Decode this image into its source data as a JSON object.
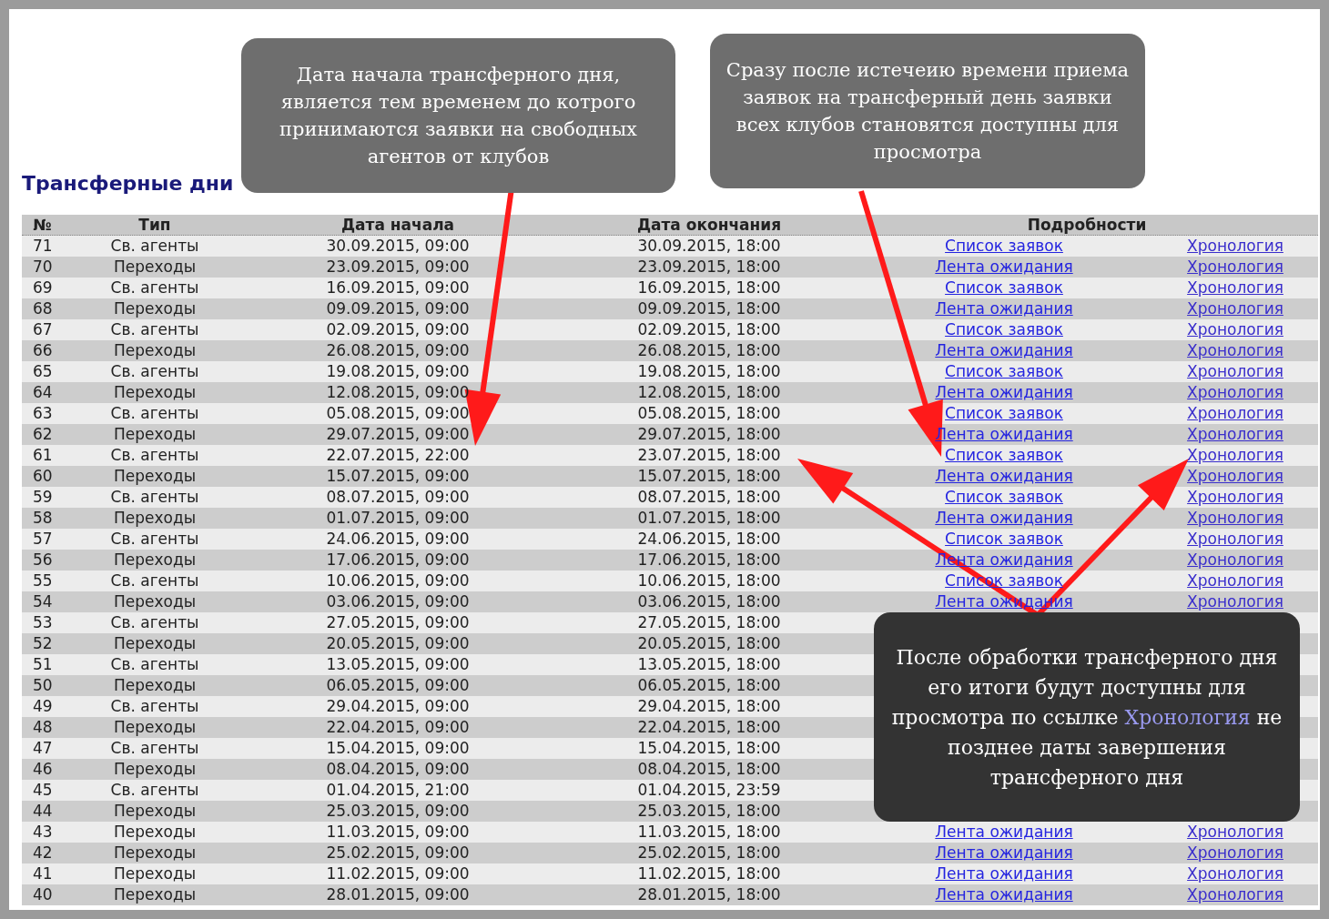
{
  "title": "Трансферные дни",
  "table": {
    "columns": [
      "№",
      "Тип",
      "Дата начала",
      "Дата окончания",
      "Подробности"
    ],
    "rows": [
      {
        "num": "71",
        "type": "Св. агенты",
        "start": "30.09.2015, 09:00",
        "end": "30.09.2015, 18:00",
        "link": "Список заявок",
        "history": "Хронология"
      },
      {
        "num": "70",
        "type": "Переходы",
        "start": "23.09.2015, 09:00",
        "end": "23.09.2015, 18:00",
        "link": "Лента ожидания",
        "history": "Хронология"
      },
      {
        "num": "69",
        "type": "Св. агенты",
        "start": "16.09.2015, 09:00",
        "end": "16.09.2015, 18:00",
        "link": "Список заявок",
        "history": "Хронология"
      },
      {
        "num": "68",
        "type": "Переходы",
        "start": "09.09.2015, 09:00",
        "end": "09.09.2015, 18:00",
        "link": "Лента ожидания",
        "history": "Хронология"
      },
      {
        "num": "67",
        "type": "Св. агенты",
        "start": "02.09.2015, 09:00",
        "end": "02.09.2015, 18:00",
        "link": "Список заявок",
        "history": "Хронология"
      },
      {
        "num": "66",
        "type": "Переходы",
        "start": "26.08.2015, 09:00",
        "end": "26.08.2015, 18:00",
        "link": "Лента ожидания",
        "history": "Хронология"
      },
      {
        "num": "65",
        "type": "Св. агенты",
        "start": "19.08.2015, 09:00",
        "end": "19.08.2015, 18:00",
        "link": "Список заявок",
        "history": "Хронология"
      },
      {
        "num": "64",
        "type": "Переходы",
        "start": "12.08.2015, 09:00",
        "end": "12.08.2015, 18:00",
        "link": "Лента ожидания",
        "history": "Хронология"
      },
      {
        "num": "63",
        "type": "Св. агенты",
        "start": "05.08.2015, 09:00",
        "end": "05.08.2015, 18:00",
        "link": "Список заявок",
        "history": "Хронология"
      },
      {
        "num": "62",
        "type": "Переходы",
        "start": "29.07.2015, 09:00",
        "end": "29.07.2015, 18:00",
        "link": "Лента ожидания",
        "history": "Хронология"
      },
      {
        "num": "61",
        "type": "Св. агенты",
        "start": "22.07.2015, 22:00",
        "end": "23.07.2015, 18:00",
        "link": "Список заявок",
        "history": "Хронология"
      },
      {
        "num": "60",
        "type": "Переходы",
        "start": "15.07.2015, 09:00",
        "end": "15.07.2015, 18:00",
        "link": "Лента ожидания",
        "history": "Хронология"
      },
      {
        "num": "59",
        "type": "Св. агенты",
        "start": "08.07.2015, 09:00",
        "end": "08.07.2015, 18:00",
        "link": "Список заявок",
        "history": "Хронология"
      },
      {
        "num": "58",
        "type": "Переходы",
        "start": "01.07.2015, 09:00",
        "end": "01.07.2015, 18:00",
        "link": "Лента ожидания",
        "history": "Хронология"
      },
      {
        "num": "57",
        "type": "Св. агенты",
        "start": "24.06.2015, 09:00",
        "end": "24.06.2015, 18:00",
        "link": "Список заявок",
        "history": "Хронология"
      },
      {
        "num": "56",
        "type": "Переходы",
        "start": "17.06.2015, 09:00",
        "end": "17.06.2015, 18:00",
        "link": "Лента ожидания",
        "history": "Хронология"
      },
      {
        "num": "55",
        "type": "Св. агенты",
        "start": "10.06.2015, 09:00",
        "end": "10.06.2015, 18:00",
        "link": "Список заявок",
        "history": "Хронология"
      },
      {
        "num": "54",
        "type": "Переходы",
        "start": "03.06.2015, 09:00",
        "end": "03.06.2015, 18:00",
        "link": "Лента ожидания",
        "history": "Хронология"
      },
      {
        "num": "53",
        "type": "Св. агенты",
        "start": "27.05.2015, 09:00",
        "end": "27.05.2015, 18:00"
      },
      {
        "num": "52",
        "type": "Переходы",
        "start": "20.05.2015, 09:00",
        "end": "20.05.2015, 18:00"
      },
      {
        "num": "51",
        "type": "Св. агенты",
        "start": "13.05.2015, 09:00",
        "end": "13.05.2015, 18:00"
      },
      {
        "num": "50",
        "type": "Переходы",
        "start": "06.05.2015, 09:00",
        "end": "06.05.2015, 18:00"
      },
      {
        "num": "49",
        "type": "Св. агенты",
        "start": "29.04.2015, 09:00",
        "end": "29.04.2015, 18:00"
      },
      {
        "num": "48",
        "type": "Переходы",
        "start": "22.04.2015, 09:00",
        "end": "22.04.2015, 18:00"
      },
      {
        "num": "47",
        "type": "Св. агенты",
        "start": "15.04.2015, 09:00",
        "end": "15.04.2015, 18:00"
      },
      {
        "num": "46",
        "type": "Переходы",
        "start": "08.04.2015, 09:00",
        "end": "08.04.2015, 18:00"
      },
      {
        "num": "45",
        "type": "Св. агенты",
        "start": "01.04.2015, 21:00",
        "end": "01.04.2015, 23:59"
      },
      {
        "num": "44",
        "type": "Переходы",
        "start": "25.03.2015, 09:00",
        "end": "25.03.2015, 18:00"
      },
      {
        "num": "43",
        "type": "Переходы",
        "start": "11.03.2015, 09:00",
        "end": "11.03.2015, 18:00",
        "link": "Лента ожидания",
        "history": "Хронология"
      },
      {
        "num": "42",
        "type": "Переходы",
        "start": "25.02.2015, 09:00",
        "end": "25.02.2015, 18:00",
        "link": "Лента ожидания",
        "history": "Хронология"
      },
      {
        "num": "41",
        "type": "Переходы",
        "start": "11.02.2015, 09:00",
        "end": "11.02.2015, 18:00",
        "link": "Лента ожидания",
        "history": "Хронология"
      },
      {
        "num": "40",
        "type": "Переходы",
        "start": "28.01.2015, 09:00",
        "end": "28.01.2015, 18:00",
        "link": "Лента ожидания",
        "history": "Хронология"
      }
    ]
  },
  "callouts": [
    {
      "segments": [
        {
          "kind": "plain",
          "text": "Дата начала трансферного дня, является тем временем до котрого принимаются заявки на свободных агентов от клубов"
        }
      ]
    },
    {
      "segments": [
        {
          "kind": "plain",
          "text": "Сразу после истечеию времени приема заявок на трансферный день заявки всех клубов становятся доступны для просмотра"
        }
      ]
    },
    {
      "segments": [
        {
          "kind": "plain",
          "text": "После обработки трансферного дня  его итоги будут доступны для просмотра по ссылке "
        },
        {
          "kind": "highlight",
          "text": "Хронология"
        },
        {
          "kind": "plain",
          "text": " не позднее даты завершения трансферного дня"
        }
      ]
    }
  ]
}
